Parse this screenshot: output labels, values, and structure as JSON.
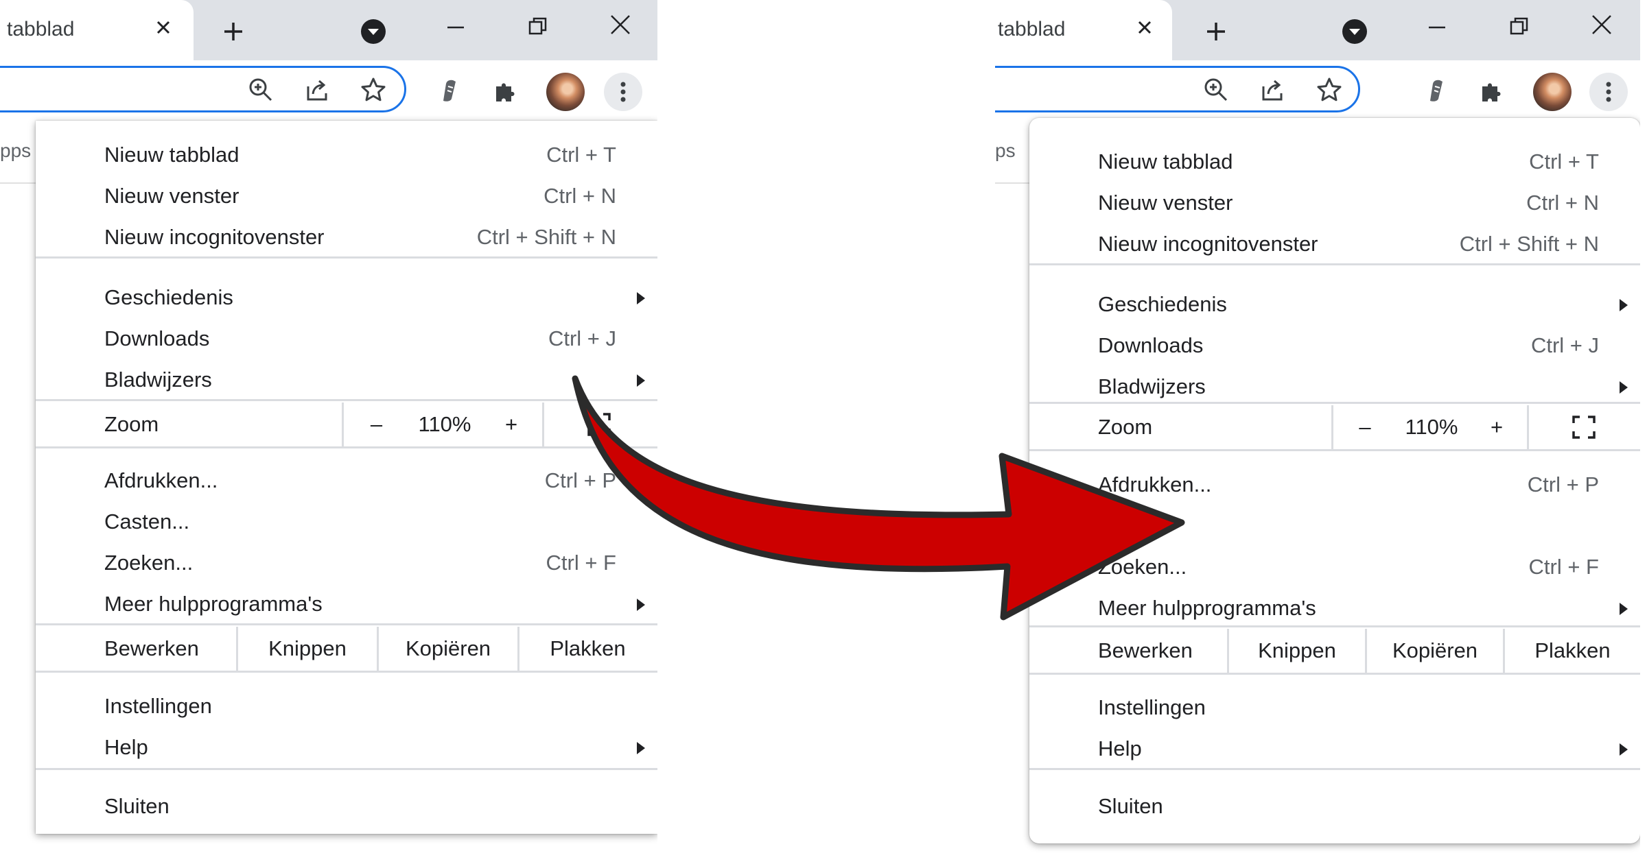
{
  "left": {
    "tab_title": "tabblad",
    "bookmarks_item": "pps",
    "menu": {
      "new_tab": {
        "label": "Nieuw tabblad",
        "shortcut": "Ctrl + T"
      },
      "new_window": {
        "label": "Nieuw venster",
        "shortcut": "Ctrl + N"
      },
      "incognito": {
        "label": "Nieuw incognitovenster",
        "shortcut": "Ctrl + Shift + N"
      },
      "history": {
        "label": "Geschiedenis"
      },
      "downloads": {
        "label": "Downloads",
        "shortcut": "Ctrl + J"
      },
      "bookmarks": {
        "label": "Bladwijzers"
      },
      "zoom": {
        "label": "Zoom",
        "minus": "–",
        "value": "110%",
        "plus": "+"
      },
      "print": {
        "label": "Afdrukken...",
        "shortcut": "Ctrl + P"
      },
      "cast": {
        "label": "Casten..."
      },
      "find": {
        "label": "Zoeken...",
        "shortcut": "Ctrl + F"
      },
      "more_tools": {
        "label": "Meer hulpprogramma's"
      },
      "edit": {
        "label": "Bewerken",
        "cut": "Knippen",
        "copy": "Kopiëren",
        "paste": "Plakken"
      },
      "settings": {
        "label": "Instellingen"
      },
      "help": {
        "label": "Help"
      },
      "exit": {
        "label": "Sluiten"
      }
    }
  },
  "right": {
    "tab_title": "tabblad",
    "bookmarks_item": "ps",
    "menu": {
      "new_tab": {
        "label": "Nieuw tabblad",
        "shortcut": "Ctrl + T"
      },
      "new_window": {
        "label": "Nieuw venster",
        "shortcut": "Ctrl + N"
      },
      "incognito": {
        "label": "Nieuw incognitovenster",
        "shortcut": "Ctrl + Shift + N"
      },
      "history": {
        "label": "Geschiedenis"
      },
      "downloads": {
        "label": "Downloads",
        "shortcut": "Ctrl + J"
      },
      "bookmarks": {
        "label": "Bladwijzers"
      },
      "zoom": {
        "label": "Zoom",
        "minus": "–",
        "value": "110%",
        "plus": "+"
      },
      "print": {
        "label": "Afdrukken...",
        "shortcut": "Ctrl + P"
      },
      "find": {
        "label": "Zoeken...",
        "shortcut": "Ctrl + F"
      },
      "more_tools": {
        "label": "Meer hulpprogramma's"
      },
      "edit": {
        "label": "Bewerken",
        "cut": "Knippen",
        "copy": "Kopiëren",
        "paste": "Plakken"
      },
      "settings": {
        "label": "Instellingen"
      },
      "help": {
        "label": "Help"
      },
      "exit": {
        "label": "Sluiten"
      }
    }
  },
  "icons": [
    "close-icon",
    "new-tab-icon",
    "tab-search-icon",
    "minimize-icon",
    "restore-icon",
    "window-close-icon",
    "zoom-icon",
    "share-icon",
    "star-icon",
    "extension-icon",
    "puzzle-icon",
    "avatar",
    "kebab-menu-icon",
    "submenu-arrow-icon",
    "fullscreen-icon",
    "red-arrow"
  ],
  "colors": {
    "accent": "#1a73e8",
    "tabstrip": "#dee1e6",
    "arrow": "#cc0000",
    "arrow_outline": "#2b2b2b"
  }
}
